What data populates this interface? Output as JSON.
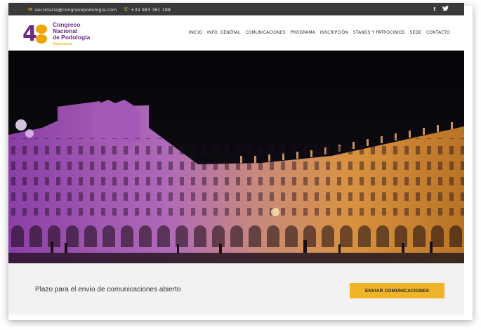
{
  "topbar": {
    "email": "secretaria@congresopodologia.com",
    "phone": "+34 983 361 188",
    "social": [
      "f",
      "t"
    ]
  },
  "logo": {
    "number_first": "4",
    "line1": "Congreso",
    "line2": "Nacional",
    "line3": "de Podología",
    "line4": "Salamanca"
  },
  "nav": {
    "items": [
      "INICIO",
      "INFO. GENERAL",
      "COMUNICACIONES",
      "PROGRAMA",
      "INSCRIPCIÓN",
      "STANDS Y PATROCINIOS",
      "SEDE",
      "CONTACTO"
    ]
  },
  "banner": {
    "message": "Plazo para el envío de comunicaciones abierto",
    "button_label": "ENVIAR COMUNICACIONES"
  },
  "colors": {
    "accent": "#f0b429",
    "brand_purple": "#6a2b86",
    "topbar": "#3a3a3a"
  }
}
